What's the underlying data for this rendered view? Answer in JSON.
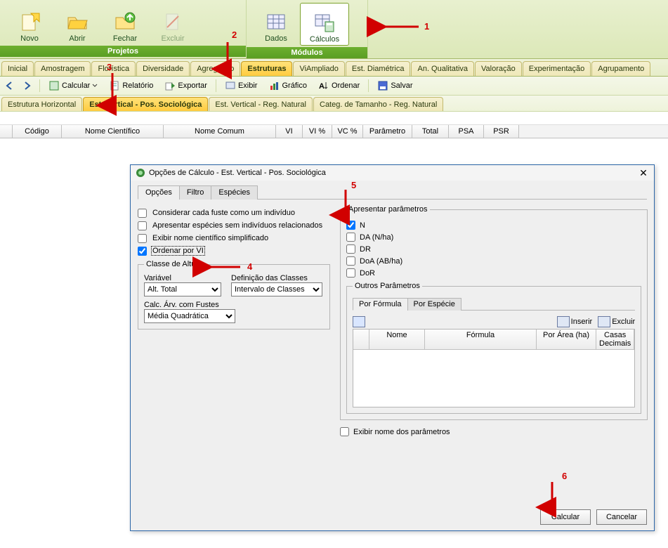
{
  "ribbon": {
    "projetos": {
      "title": "Projetos",
      "novo": "Novo",
      "abrir": "Abrir",
      "fechar": "Fechar",
      "excluir": "Excluir"
    },
    "modulos": {
      "title": "Módulos",
      "dados": "Dados",
      "calculos": "Cálculos"
    }
  },
  "tabs": {
    "inicial": "Inicial",
    "amostragem": "Amostragem",
    "floristica": "Florística",
    "diversidade": "Diversidade",
    "agregacao": "Agregação",
    "estruturas": "Estruturas",
    "viampliado": "ViAmpliado",
    "est_diametrica": "Est. Diamétrica",
    "an_qualitativa": "An. Qualitativa",
    "valoracao": "Valoração",
    "experimentacao": "Experimentação",
    "agrupamento": "Agrupamento"
  },
  "toolbar": {
    "calcular": "Calcular",
    "relatorio": "Relatório",
    "exportar": "Exportar",
    "exibir": "Exibir",
    "grafico": "Gráfico",
    "ordenar": "Ordenar",
    "salvar": "Salvar"
  },
  "subtabs": {
    "horizontal": "Estrutura Horizontal",
    "vertical_pos": "Est. Vertical - Pos. Sociológica",
    "vertical_reg": "Est. Vertical - Reg. Natural",
    "categ": "Categ. de Tamanho - Reg. Natural"
  },
  "grid_cols": {
    "codigo": "Código",
    "nome_cientifico": "Nome Científico",
    "nome_comum": "Nome Comum",
    "vi": "VI",
    "vi_pct": "VI %",
    "vc_pct": "VC %",
    "parametro": "Parâmetro",
    "total": "Total",
    "psa": "PSA",
    "psr": "PSR"
  },
  "dialog": {
    "title": "Opções de Cálculo - Est. Vertical - Pos. Sociológica",
    "tabs": {
      "opcoes": "Opções",
      "filtro": "Filtro",
      "especies": "Espécies"
    },
    "left": {
      "considerar": "Considerar cada fuste como um indivíduo",
      "apresentar_esp": "Apresentar espécies sem indivíduos relacionados",
      "exibir_simpl": "Exibir nome científico simplificado",
      "ordenar": "Ordenar por VI",
      "classe_legend": "Classe de Altura",
      "variavel_lbl": "Variável",
      "variavel_val": "Alt. Total",
      "defclasses_lbl": "Definição das Classes",
      "defclasses_val": "Intervalo de Classes",
      "calc_fustes_lbl": "Calc. Árv. com Fustes",
      "calc_fustes_val": "Média Quadrática"
    },
    "right": {
      "apresentar_legend": "Apresentar parâmetros",
      "n": "N",
      "da": "DA (N/ha)",
      "dr": "DR",
      "doa": "DoA (AB/ha)",
      "dor": "DoR",
      "outros_legend": "Outros Parâmetros",
      "por_formula": "Por Fórmula",
      "por_especie": "Por Espécie",
      "inserir": "Inserir",
      "excluir": "Excluir",
      "col_nome": "Nome",
      "col_formula": "Fórmula",
      "col_area": "Por Área (ha)",
      "col_dec": "Casas Decimais",
      "exibir_nome_param": "Exibir nome dos parâmetros"
    },
    "foot": {
      "calcular": "Calcular",
      "cancelar": "Cancelar"
    }
  },
  "annotations": {
    "a1": "1",
    "a2": "2",
    "a3": "3",
    "a4": "4",
    "a5": "5",
    "a6": "6"
  }
}
